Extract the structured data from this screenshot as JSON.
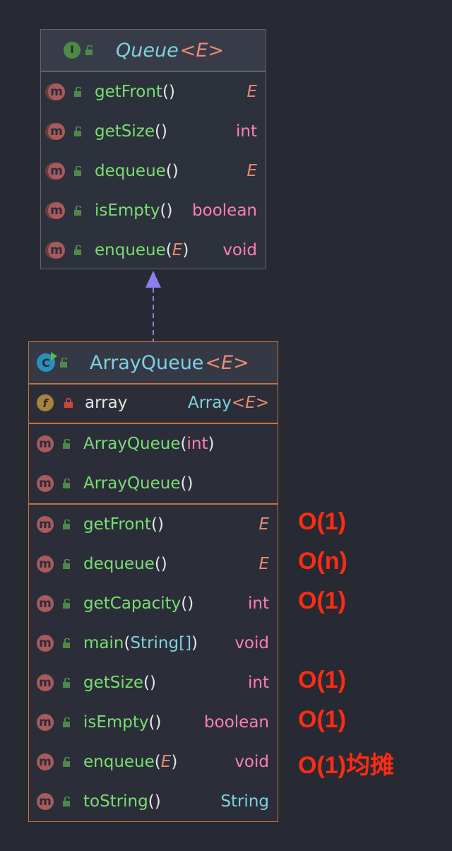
{
  "interface": {
    "badge": "I",
    "name": "Queue",
    "type_param": "<E>",
    "methods": [
      {
        "name": "getFront",
        "args": "",
        "returns": "E"
      },
      {
        "name": "getSize",
        "args": "",
        "returns": "int"
      },
      {
        "name": "dequeue",
        "args": "",
        "returns": "E"
      },
      {
        "name": "isEmpty",
        "args": "",
        "returns": "boolean"
      },
      {
        "name": "enqueue",
        "args": "E",
        "returns": "void"
      }
    ]
  },
  "class": {
    "name": "ArrayQueue",
    "type_param": "<E>",
    "field": {
      "name": "array",
      "type": "Array",
      "type_param": "<E>"
    },
    "constructors": [
      {
        "name": "ArrayQueue",
        "args": "int"
      },
      {
        "name": "ArrayQueue",
        "args": ""
      }
    ],
    "methods": [
      {
        "name": "getFront",
        "args": "",
        "returns": "E",
        "complexity": "O(1)"
      },
      {
        "name": "dequeue",
        "args": "",
        "returns": "E",
        "complexity": "O(n)"
      },
      {
        "name": "getCapacity",
        "args": "",
        "returns": "int",
        "complexity": "O(1)"
      },
      {
        "name": "main",
        "args": "String[]",
        "returns": "void",
        "complexity": ""
      },
      {
        "name": "getSize",
        "args": "",
        "returns": "int",
        "complexity": "O(1)"
      },
      {
        "name": "isEmpty",
        "args": "",
        "returns": "boolean",
        "complexity": "O(1)"
      },
      {
        "name": "enqueue",
        "args": "E",
        "returns": "void",
        "complexity": "O(1)均摊"
      },
      {
        "name": "toString",
        "args": "",
        "returns": "String",
        "complexity": ""
      }
    ]
  },
  "colors": {
    "background": "#272a33",
    "method_name": "#79dd73",
    "primitive": "#ff7fb4",
    "type_var": "#e88b72",
    "class_ref": "#7ed0e0",
    "class_border": "#c4733d",
    "arrow": "#8f7cf0",
    "annotation": "#ff2b12"
  }
}
